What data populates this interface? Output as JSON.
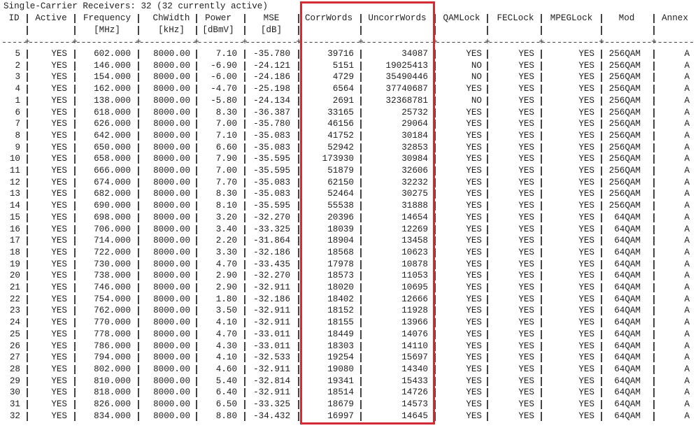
{
  "title": "Single-Carrier Receivers: 32 (32 currently active)",
  "highlight_color": "#d42a33",
  "highlighted_columns": [
    "CorrWords",
    "UncorrWords"
  ],
  "columns": [
    {
      "label": "ID",
      "unit": ""
    },
    {
      "label": "Active",
      "unit": ""
    },
    {
      "label": "Frequency",
      "unit": "[MHz]"
    },
    {
      "label": "ChWidth",
      "unit": "[kHz]"
    },
    {
      "label": "Power",
      "unit": "[dBmV]"
    },
    {
      "label": "MSE",
      "unit": "[dB]"
    },
    {
      "label": "CorrWords",
      "unit": ""
    },
    {
      "label": "UncorrWords",
      "unit": ""
    },
    {
      "label": "QAMLock",
      "unit": ""
    },
    {
      "label": "FECLock",
      "unit": ""
    },
    {
      "label": "MPEGLock",
      "unit": ""
    },
    {
      "label": "Mod",
      "unit": ""
    },
    {
      "label": "Annex",
      "unit": ""
    }
  ],
  "rows": [
    [
      "5",
      "YES",
      "602.000",
      "8000.00",
      "7.10",
      "-35.780",
      "39716",
      "34087",
      "YES",
      "YES",
      "YES",
      "256QAM",
      "A"
    ],
    [
      "2",
      "YES",
      "146.000",
      "8000.00",
      "-6.90",
      "-24.121",
      "5151",
      "19025413",
      "NO",
      "YES",
      "YES",
      "256QAM",
      "A"
    ],
    [
      "3",
      "YES",
      "154.000",
      "8000.00",
      "-6.00",
      "-24.186",
      "4729",
      "35490446",
      "NO",
      "YES",
      "YES",
      "256QAM",
      "A"
    ],
    [
      "4",
      "YES",
      "162.000",
      "8000.00",
      "-4.70",
      "-25.198",
      "6564",
      "37740687",
      "YES",
      "YES",
      "YES",
      "256QAM",
      "A"
    ],
    [
      "1",
      "YES",
      "138.000",
      "8000.00",
      "-5.80",
      "-24.134",
      "2691",
      "32368781",
      "NO",
      "YES",
      "YES",
      "256QAM",
      "A"
    ],
    [
      "6",
      "YES",
      "618.000",
      "8000.00",
      "8.30",
      "-36.387",
      "33165",
      "25732",
      "YES",
      "YES",
      "YES",
      "256QAM",
      "A"
    ],
    [
      "7",
      "YES",
      "626.000",
      "8000.00",
      "7.00",
      "-35.780",
      "46156",
      "29064",
      "YES",
      "YES",
      "YES",
      "256QAM",
      "A"
    ],
    [
      "8",
      "YES",
      "642.000",
      "8000.00",
      "7.10",
      "-35.083",
      "41752",
      "30184",
      "YES",
      "YES",
      "YES",
      "256QAM",
      "A"
    ],
    [
      "9",
      "YES",
      "650.000",
      "8000.00",
      "6.60",
      "-35.083",
      "52942",
      "32853",
      "YES",
      "YES",
      "YES",
      "256QAM",
      "A"
    ],
    [
      "10",
      "YES",
      "658.000",
      "8000.00",
      "7.90",
      "-35.595",
      "173930",
      "30984",
      "YES",
      "YES",
      "YES",
      "256QAM",
      "A"
    ],
    [
      "11",
      "YES",
      "666.000",
      "8000.00",
      "7.00",
      "-35.595",
      "51879",
      "32606",
      "YES",
      "YES",
      "YES",
      "256QAM",
      "A"
    ],
    [
      "12",
      "YES",
      "674.000",
      "8000.00",
      "7.70",
      "-35.083",
      "62150",
      "32232",
      "YES",
      "YES",
      "YES",
      "256QAM",
      "A"
    ],
    [
      "13",
      "YES",
      "682.000",
      "8000.00",
      "8.30",
      "-35.083",
      "52464",
      "30275",
      "YES",
      "YES",
      "YES",
      "256QAM",
      "A"
    ],
    [
      "14",
      "YES",
      "690.000",
      "8000.00",
      "8.10",
      "-35.595",
      "55538",
      "31888",
      "YES",
      "YES",
      "YES",
      "256QAM",
      "A"
    ],
    [
      "15",
      "YES",
      "698.000",
      "8000.00",
      "3.20",
      "-32.270",
      "20396",
      "14654",
      "YES",
      "YES",
      "YES",
      "64QAM",
      "A"
    ],
    [
      "16",
      "YES",
      "706.000",
      "8000.00",
      "3.40",
      "-33.325",
      "18039",
      "12269",
      "YES",
      "YES",
      "YES",
      "64QAM",
      "A"
    ],
    [
      "17",
      "YES",
      "714.000",
      "8000.00",
      "2.20",
      "-31.864",
      "18904",
      "13458",
      "YES",
      "YES",
      "YES",
      "64QAM",
      "A"
    ],
    [
      "18",
      "YES",
      "722.000",
      "8000.00",
      "3.30",
      "-32.186",
      "18568",
      "10623",
      "YES",
      "YES",
      "YES",
      "64QAM",
      "A"
    ],
    [
      "19",
      "YES",
      "730.000",
      "8000.00",
      "4.70",
      "-33.435",
      "17978",
      "10878",
      "YES",
      "YES",
      "YES",
      "64QAM",
      "A"
    ],
    [
      "20",
      "YES",
      "738.000",
      "8000.00",
      "2.90",
      "-32.270",
      "18573",
      "11053",
      "YES",
      "YES",
      "YES",
      "64QAM",
      "A"
    ],
    [
      "21",
      "YES",
      "746.000",
      "8000.00",
      "2.90",
      "-32.911",
      "18020",
      "10695",
      "YES",
      "YES",
      "YES",
      "64QAM",
      "A"
    ],
    [
      "22",
      "YES",
      "754.000",
      "8000.00",
      "1.80",
      "-32.186",
      "18402",
      "12666",
      "YES",
      "YES",
      "YES",
      "64QAM",
      "A"
    ],
    [
      "23",
      "YES",
      "762.000",
      "8000.00",
      "3.50",
      "-32.911",
      "18152",
      "11928",
      "YES",
      "YES",
      "YES",
      "64QAM",
      "A"
    ],
    [
      "24",
      "YES",
      "770.000",
      "8000.00",
      "4.10",
      "-32.911",
      "18155",
      "13966",
      "YES",
      "YES",
      "YES",
      "64QAM",
      "A"
    ],
    [
      "25",
      "YES",
      "778.000",
      "8000.00",
      "4.70",
      "-33.011",
      "18449",
      "14076",
      "YES",
      "YES",
      "YES",
      "64QAM",
      "A"
    ],
    [
      "26",
      "YES",
      "786.000",
      "8000.00",
      "4.30",
      "-33.011",
      "18303",
      "14110",
      "YES",
      "YES",
      "YES",
      "64QAM",
      "A"
    ],
    [
      "27",
      "YES",
      "794.000",
      "8000.00",
      "4.10",
      "-32.533",
      "19254",
      "15697",
      "YES",
      "YES",
      "YES",
      "64QAM",
      "A"
    ],
    [
      "28",
      "YES",
      "802.000",
      "8000.00",
      "4.60",
      "-32.911",
      "19080",
      "14340",
      "YES",
      "YES",
      "YES",
      "64QAM",
      "A"
    ],
    [
      "29",
      "YES",
      "810.000",
      "8000.00",
      "5.40",
      "-32.814",
      "19341",
      "15433",
      "YES",
      "YES",
      "YES",
      "64QAM",
      "A"
    ],
    [
      "30",
      "YES",
      "818.000",
      "8000.00",
      "6.40",
      "-32.911",
      "18514",
      "14726",
      "YES",
      "YES",
      "YES",
      "64QAM",
      "A"
    ],
    [
      "31",
      "YES",
      "826.000",
      "8000.00",
      "6.50",
      "-33.325",
      "18679",
      "14573",
      "YES",
      "YES",
      "YES",
      "64QAM",
      "A"
    ],
    [
      "32",
      "YES",
      "834.000",
      "8000.00",
      "8.80",
      "-34.432",
      "16997",
      "14645",
      "YES",
      "YES",
      "YES",
      "64QAM",
      "A"
    ]
  ]
}
